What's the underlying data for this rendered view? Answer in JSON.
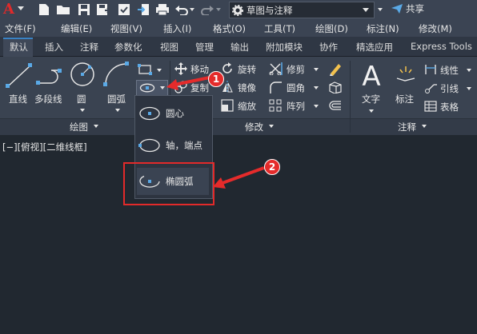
{
  "app": {
    "logo_letter": "A",
    "workspace": "草图与注释",
    "share": "共享"
  },
  "menu": [
    "文件(F)",
    "编辑(E)",
    "视图(V)",
    "插入(I)",
    "格式(O)",
    "工具(T)",
    "绘图(D)",
    "标注(N)",
    "修改(M)"
  ],
  "tabs": [
    "默认",
    "插入",
    "注释",
    "参数化",
    "视图",
    "管理",
    "输出",
    "附加模块",
    "协作",
    "精选应用",
    "Express Tools"
  ],
  "ribbon": {
    "draw": {
      "line": "直线",
      "polyline": "多段线",
      "circle": "圆",
      "arc": "圆弧",
      "title": "绘图"
    },
    "modify": {
      "move": "移动",
      "rotate": "旋转",
      "trim": "修剪",
      "copy": "复制",
      "mirror": "镜像",
      "fillet": "圆角",
      "scale": "缩放",
      "array": "阵列",
      "title": "修改"
    },
    "annotation": {
      "text": "文字",
      "dimension": "标注",
      "linear": "线性",
      "leader": "引线",
      "table": "表格",
      "title": "注释"
    }
  },
  "viewport_label": "[−][俯视][二维线框]",
  "ellipse_menu": {
    "center": "圆心",
    "axis_end": "轴，端点",
    "arc": "椭圆弧"
  },
  "callouts": {
    "step1": "1",
    "step2": "2"
  },
  "colors": {
    "accent_red": "#e52b2b",
    "tab_active_border": "#3a82c4",
    "icon_blue": "#5aa9e6"
  }
}
